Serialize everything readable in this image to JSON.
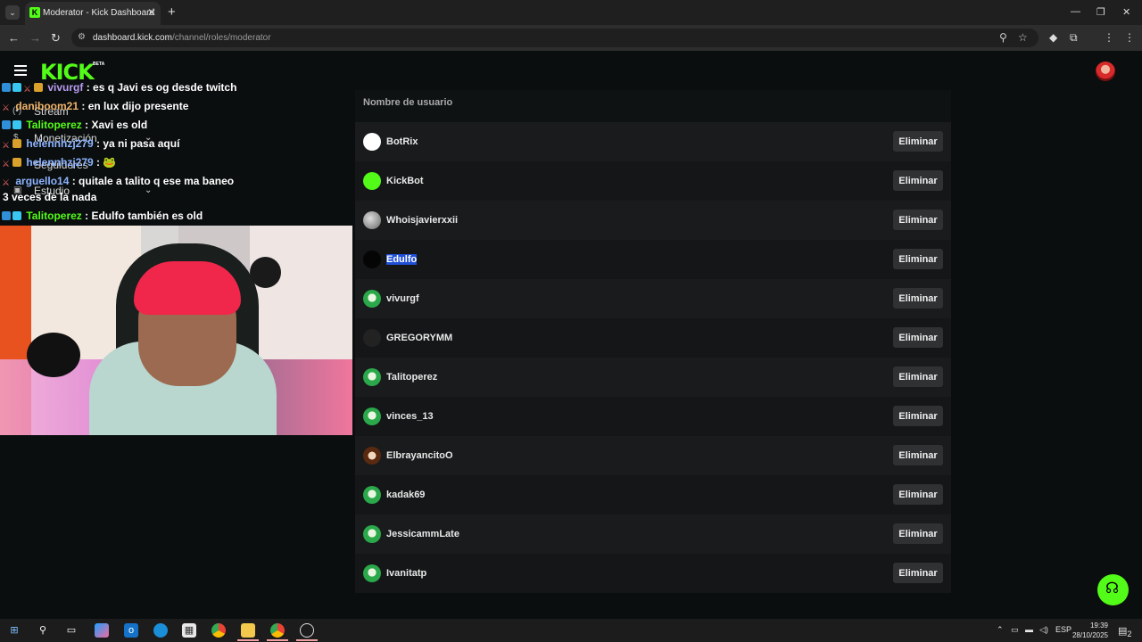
{
  "browser": {
    "tab_title": "Moderator - Kick Dashboard",
    "url_domain": "dashboard.kick.com",
    "url_path": "/channel/roles/moderator",
    "new_tab": "+",
    "tab_close": "✕"
  },
  "header": {
    "logo": "KICK",
    "beta": "BETA"
  },
  "sidebar": {
    "items": [
      {
        "label": "Stream"
      },
      {
        "label": "Monetización"
      },
      {
        "label": "Seguidores"
      },
      {
        "label": "Estudio"
      }
    ]
  },
  "chat": {
    "lines": [
      {
        "user": "vivurgf",
        "text": " : es q Javi es og desde twitch"
      },
      {
        "user": "daniboom21",
        "text": " : en lux dijo presente"
      },
      {
        "user": "Talitoperez",
        "text": " : Xavi es old"
      },
      {
        "user": "helennhzj279",
        "text": " : ya ni pasa aquí"
      },
      {
        "user": "helennhzj279",
        "text": " : "
      },
      {
        "user": "arguello14",
        "text": " : quitale a talito q ese ma baneo"
      },
      {
        "user": "Talitoperez",
        "text": " : Edulfo también es old"
      }
    ],
    "wrap_text": "3 veces de la nada"
  },
  "moderators": {
    "column_header": "Nombre de usuario",
    "remove_label": "Eliminar",
    "rows": [
      {
        "name": "BotRix",
        "avatar": "botrix",
        "selected": false
      },
      {
        "name": "KickBot",
        "avatar": "kickbot",
        "selected": false
      },
      {
        "name": "Whoisjavierxxii",
        "avatar": "grey",
        "selected": false
      },
      {
        "name": "Edulfo",
        "avatar": "dark",
        "selected": true
      },
      {
        "name": "vivurgf",
        "avatar": "green",
        "selected": false
      },
      {
        "name": "GREGORYMM",
        "avatar": "letter-g",
        "selected": false
      },
      {
        "name": "Talitoperez",
        "avatar": "green",
        "selected": false
      },
      {
        "name": "vinces_13",
        "avatar": "green",
        "selected": false
      },
      {
        "name": "ElbrayancitoO",
        "avatar": "brown",
        "selected": false
      },
      {
        "name": "kadak69",
        "avatar": "green",
        "selected": false
      },
      {
        "name": "JessicammLate",
        "avatar": "green",
        "selected": false
      },
      {
        "name": "Ivanitatp",
        "avatar": "green",
        "selected": false
      }
    ]
  },
  "taskbar": {
    "language": "ESP",
    "time": "19:39",
    "date": "28/10/2025",
    "notifications": "2"
  },
  "colors": {
    "brand": "#53fc18",
    "selection": "#1f4fd6"
  }
}
